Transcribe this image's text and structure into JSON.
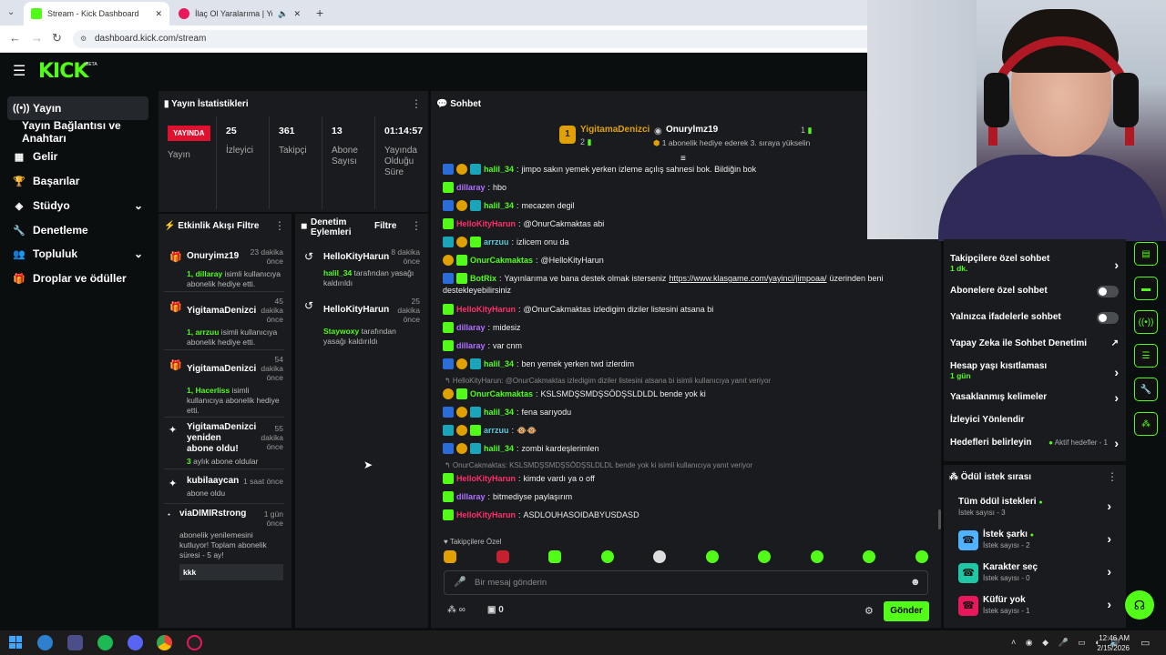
{
  "browser": {
    "tabs": [
      {
        "label": "Stream - Kick Dashboard",
        "active": true
      },
      {
        "label": "İlaç Ol Yaralarıma | YouTube",
        "active": false
      }
    ],
    "new_tab": "+",
    "url": "dashboard.kick.com/stream"
  },
  "logo": {
    "text": "KICK",
    "badge": "BETA"
  },
  "sidebar": {
    "items": [
      {
        "label": "Yayın",
        "icon": "broadcast-icon",
        "active": true
      },
      {
        "label": "Yayın Bağlantısı ve Anahtarı",
        "icon": "",
        "active": false
      },
      {
        "label": "Gelir",
        "icon": "dollar-icon",
        "active": false
      },
      {
        "label": "Başarılar",
        "icon": "trophy-icon",
        "active": false
      },
      {
        "label": "Stüdyo",
        "icon": "layers-icon",
        "active": false,
        "expand": true
      },
      {
        "label": "Denetleme",
        "icon": "wrench-icon",
        "active": false
      },
      {
        "label": "Topluluk",
        "icon": "users-icon",
        "active": false,
        "expand": true
      },
      {
        "label": "Droplar ve ödüller",
        "icon": "gift-icon",
        "active": false
      }
    ]
  },
  "stats": {
    "title": "Yayın İstatistikleri",
    "live_badge": "YAYINDA",
    "items": [
      {
        "value": "",
        "label": "Yayın"
      },
      {
        "value": "25",
        "label": "İzleyici"
      },
      {
        "value": "361",
        "label": "Takipçi"
      },
      {
        "value": "13",
        "label": "Abone Sayısı"
      },
      {
        "value": "01:14:57",
        "label": "Yayında Olduğu Süre"
      }
    ]
  },
  "activity": {
    "title": "Etkinlik Akışı",
    "filter": "Filtre",
    "items": [
      {
        "name": "Onuryimz19",
        "time": "23 dakika önce",
        "desc_pre": "1, dillaray",
        "desc": " isimli kullanıcıya abonelik hediye etti."
      },
      {
        "name": "YigitamaDenizci",
        "time": "45 dakika önce",
        "desc_pre": "1, arrzuu",
        "desc": " isimli kullanıcıya abonelik hediye etti."
      },
      {
        "name": "YigitamaDenizci",
        "time": "54 dakika önce",
        "desc_pre": "1, Hacerliss",
        "desc": " isimli kullanıcıya abonelik hediye etti."
      },
      {
        "name": "YigitamaDenizci yeniden abone oldu!",
        "time": "55 dakika önce",
        "desc_pre": "3",
        "desc": " aylık abone oldular"
      },
      {
        "name": "kubilaaycan",
        "time": "1 saat önce",
        "desc_pre": "",
        "desc": "abone oldu"
      },
      {
        "name": "viaDIMIRstrong",
        "time": "1 gün önce",
        "desc_pre": "",
        "desc": "abonelik yenilemesini kutluyor! Toplam abonelik süresi - 5 ay!",
        "extra": "kkk"
      }
    ]
  },
  "moderation": {
    "title": "Denetim Eylemleri",
    "filter": "Filtre",
    "items": [
      {
        "name": "HelloKityHarun",
        "time": "8 dakika önce",
        "desc_pre": "halil_34",
        "desc": " tarafından yasağı kaldırıldı"
      },
      {
        "name": "HelloKityHarun",
        "time": "25 dakika önce",
        "desc_pre": "Staywoxy",
        "desc": " tarafından yasağı kaldırıldı"
      }
    ]
  },
  "chat": {
    "title": "Sohbet",
    "pinned": {
      "user1": "YigitamaDenizci",
      "count1": "2",
      "user2": "Onurylmz19",
      "count2": "1",
      "sub": "1 abonelik hediye ederek 3. sıraya yükselin"
    },
    "messages": [
      {
        "badges": [
          "bb",
          "by",
          "bc"
        ],
        "user": "halil_34",
        "color": "ug",
        "text": "jimpo sakın yemek yerken izleme açılış sahnesi bok. Bildiğin bok"
      },
      {
        "badges": [
          "bg"
        ],
        "user": "dillaray",
        "color": "up",
        "text": "hbo"
      },
      {
        "badges": [
          "bb",
          "by",
          "bc"
        ],
        "user": "halil_34",
        "color": "ug",
        "text": "mecazen degil"
      },
      {
        "badges": [
          "bg"
        ],
        "user": "HelloKityHarun",
        "color": "ur",
        "text": "@OnurCakmaktas abi"
      },
      {
        "badges": [
          "bc",
          "by",
          "bg"
        ],
        "user": "arrzuu",
        "color": "ut",
        "text": "izlicem onu da"
      },
      {
        "badges": [
          "by",
          "bg"
        ],
        "user": "OnurCakmaktas",
        "color": "ug",
        "text": "@HelloKityHarun"
      },
      {
        "badges": [
          "bb",
          "bg"
        ],
        "user": "BotRix",
        "color": "ug",
        "text": "Yayınlarıma ve bana destek olmak isterseniz",
        "link": "https://www.klasgame.com/yayinci/jimpoaa/",
        "text2": " üzerinden beni",
        "wrap": "destekleyebilirsiniz"
      },
      {
        "badges": [
          "bg"
        ],
        "user": "HelloKityHarun",
        "color": "ur",
        "text": "@OnurCakmaktas izledigim diziler listesini atsana bi"
      },
      {
        "badges": [
          "bg"
        ],
        "user": "dillaray",
        "color": "up",
        "text": "midesiz"
      },
      {
        "badges": [
          "bg"
        ],
        "user": "dillaray",
        "color": "up",
        "text": "var cnm"
      },
      {
        "badges": [
          "bb",
          "by",
          "bc"
        ],
        "user": "halil_34",
        "color": "ug",
        "text": "ben yemek yerken twd izlerdim"
      },
      {
        "reply": "HelloKityHarun: @OnurCakmaktas izledigim diziler listesini atsana bi isimli kullanıcıya yanıt veriyor",
        "badges": [
          "by",
          "bg"
        ],
        "user": "OnurCakmaktas",
        "color": "ug",
        "text": "KSLSMDŞSMDŞSÖDŞSLDLDL bende yok ki"
      },
      {
        "badges": [
          "bb",
          "by",
          "bc"
        ],
        "user": "halil_34",
        "color": "ug",
        "text": "fena sarıyodu"
      },
      {
        "badges": [
          "bc",
          "by",
          "bg"
        ],
        "user": "arrzuu",
        "color": "ut",
        "text": "🐵🐵"
      },
      {
        "badges": [
          "bb",
          "by",
          "bc"
        ],
        "user": "halil_34",
        "color": "ug",
        "text": "zombi kardeşlerimlen"
      },
      {
        "reply": "OnurCakmaktas: KSLSMDŞSMDŞSÖDŞSLDLDL bende yok ki isimli kullanıcıya yanıt veriyor",
        "badges": [
          "bg"
        ],
        "user": "HelloKityHarun",
        "color": "ur",
        "text": "kimde vardı ya o off"
      },
      {
        "badges": [
          "bg"
        ],
        "user": "dillaray",
        "color": "up",
        "text": "bitmediyse paylaşırım"
      },
      {
        "badges": [
          "bg"
        ],
        "user": "HelloKityHarun",
        "color": "ur",
        "text": "ASDLOUHASOIDABYUSDASD"
      }
    ],
    "followers_only": "Takipçilere Özel",
    "input_placeholder": "Bir mesaj gönderin",
    "points": "∞",
    "gifts": "0",
    "send": "Gönder"
  },
  "settings": {
    "items": [
      {
        "label": "Takipçilere özel sohbet",
        "sub": "1 dk.",
        "type": "chevron"
      },
      {
        "label": "Abonelere özel sohbet",
        "type": "toggle"
      },
      {
        "label": "Yalnızca ifadelerle sohbet",
        "type": "toggle"
      },
      {
        "label": "Yapay Zeka ile Sohbet Denetimi",
        "type": "external"
      },
      {
        "label": "Hesap yaşı kısıtlaması",
        "sub": "1 gün",
        "type": "chevron"
      },
      {
        "label": "Yasaklanmış kelimeler",
        "type": "chevron"
      },
      {
        "label": "İzleyici Yönlendir",
        "type": "none"
      },
      {
        "label": "Hedefleri belirleyin",
        "note": "Aktif hedefler - 1",
        "type": "chevron"
      }
    ]
  },
  "rewards": {
    "title": "Ödül istek sırası",
    "items": [
      {
        "label": "Tüm ödül istekleri",
        "sub": "İstek sayısı - 3",
        "color": "#53fc18"
      },
      {
        "label": "İstek şarkı",
        "sub": "İstek sayısı - 2",
        "color": "#4fb3ff"
      },
      {
        "label": "Karakter seç",
        "sub": "İstek sayısı - 0",
        "color": "#1fc7a6"
      },
      {
        "label": "Küfür yok",
        "sub": "İstek sayısı - 1",
        "color": "#e8185a"
      }
    ]
  },
  "taskbar": {
    "time": "12:46 AM",
    "date": "2/15/2026"
  }
}
